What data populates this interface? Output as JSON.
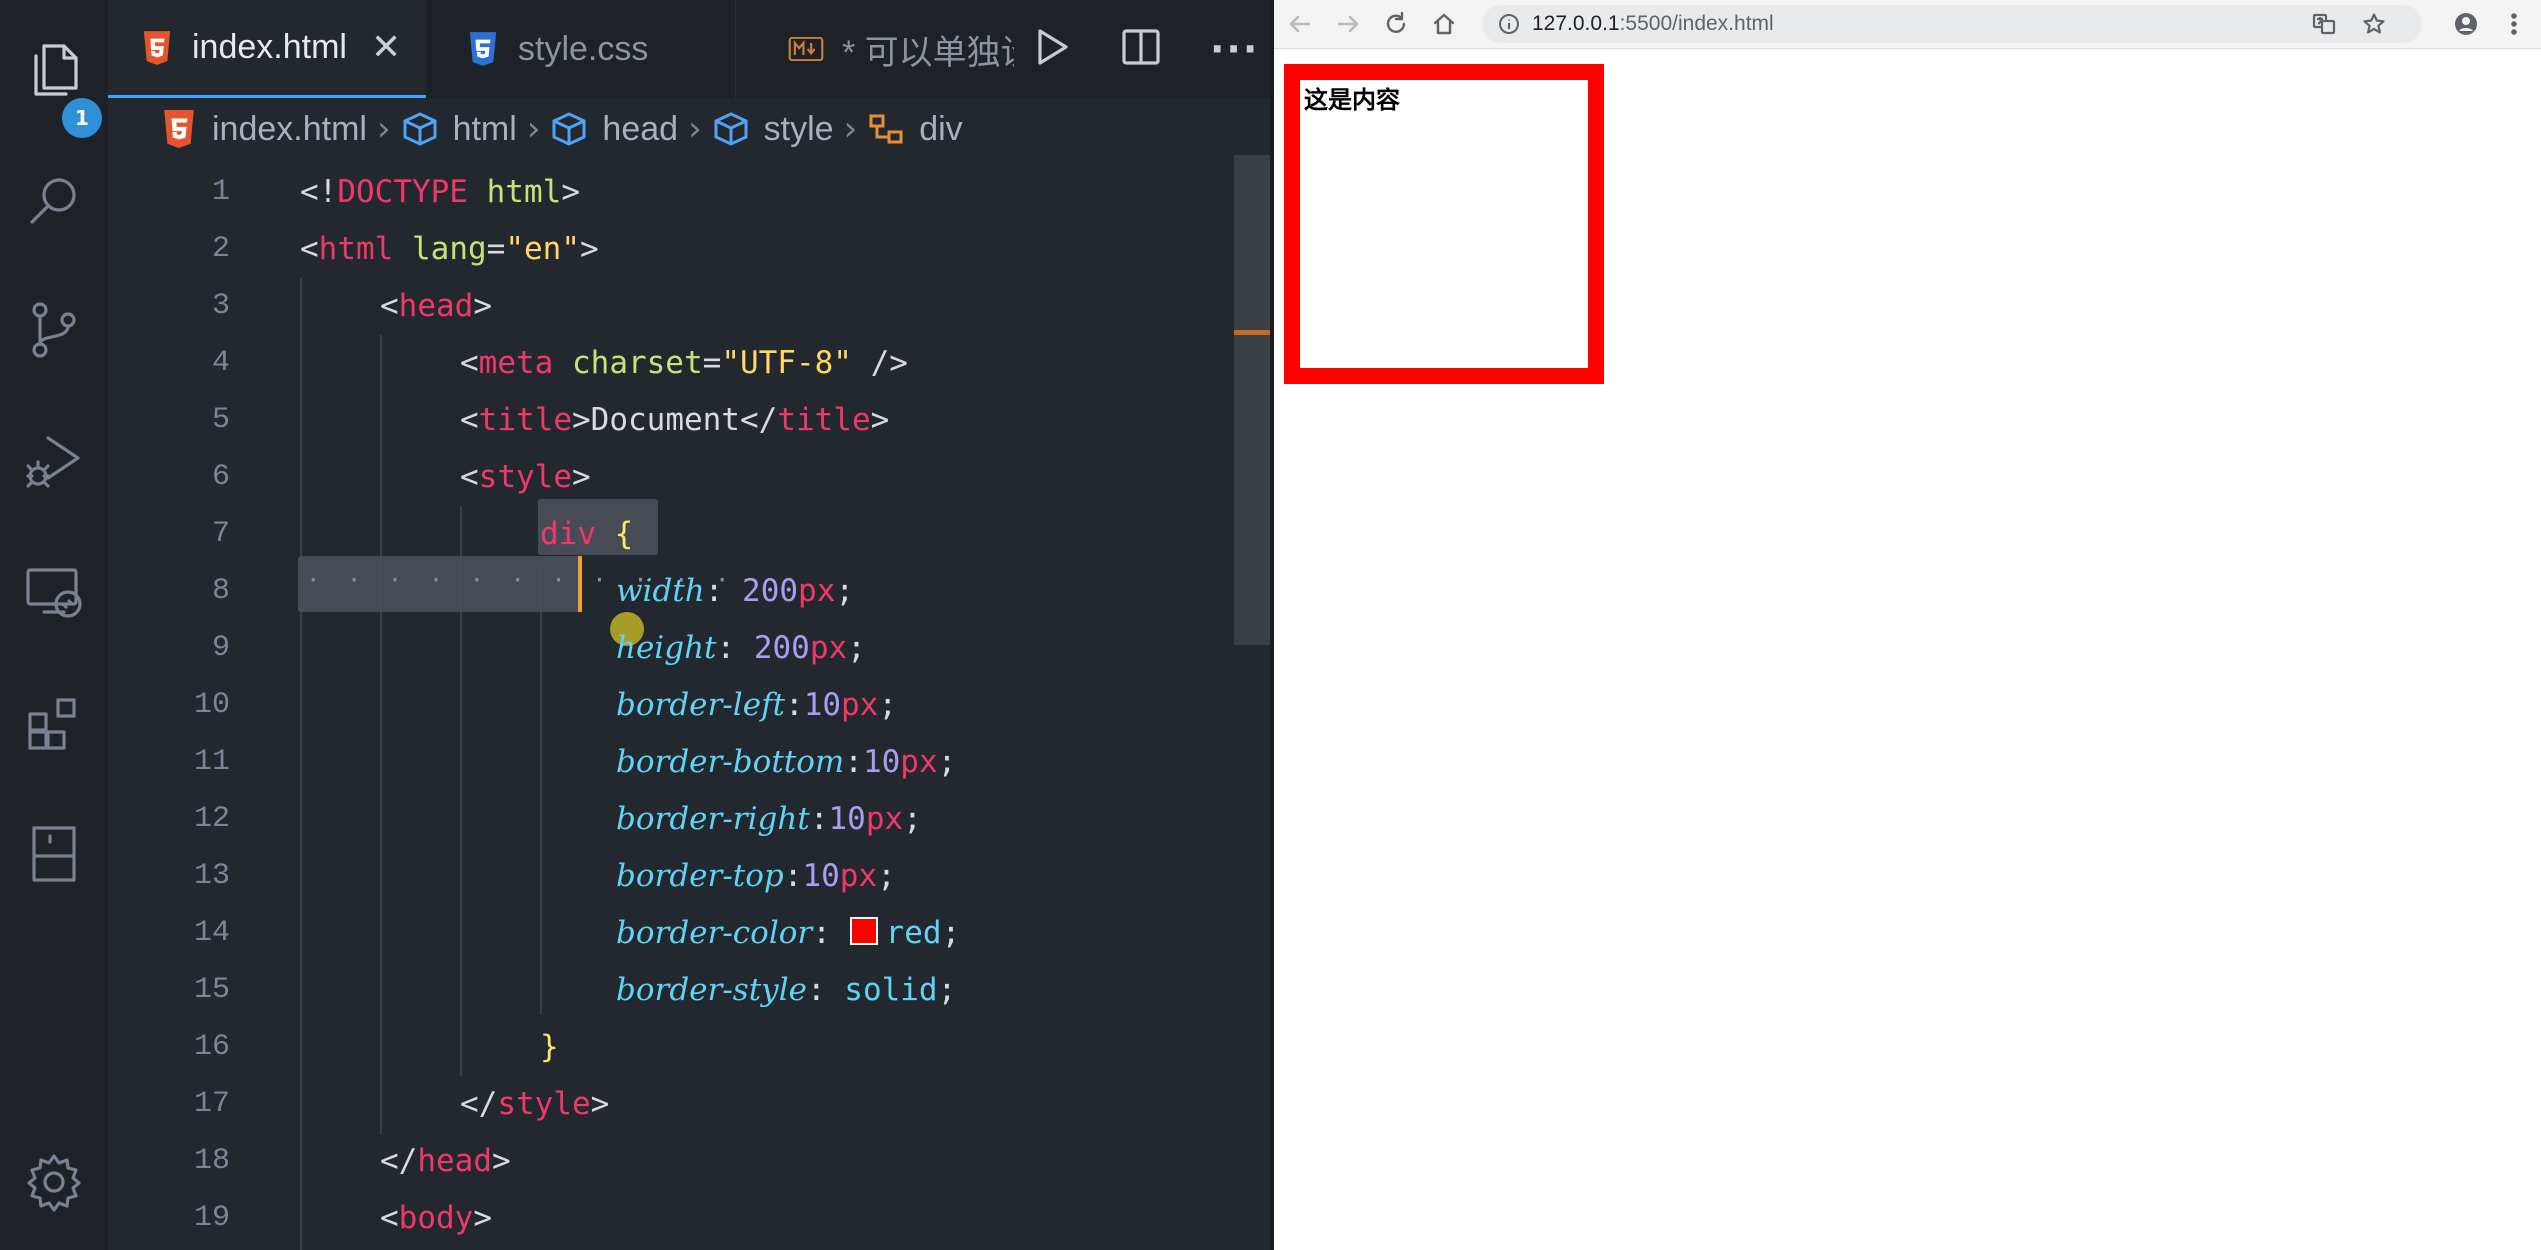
{
  "editor": {
    "scm_badge": "1",
    "tabs": [
      {
        "label": "index.html",
        "icon": "html5-file-icon",
        "active": true
      },
      {
        "label": "style.css",
        "icon": "css3-file-icon",
        "active": false
      },
      {
        "label": "* 可以单独设",
        "icon": "markdown-file-icon",
        "active": false
      }
    ],
    "breadcrumb": [
      "index.html",
      "html",
      "head",
      "style",
      "div"
    ],
    "line_numbers": [
      "1",
      "2",
      "3",
      "4",
      "5",
      "6",
      "7",
      "8",
      "9",
      "10",
      "11",
      "12",
      "13",
      "14",
      "15",
      "16",
      "17",
      "18",
      "19"
    ],
    "code": {
      "l1": {
        "a": "<!",
        "b": "DOCTYPE",
        "c": " html",
        "d": ">"
      },
      "l2": {
        "a": "<",
        "b": "html",
        "c": " lang",
        "d": "=",
        "e": "\"en\"",
        "f": ">"
      },
      "l3": {
        "a": "<",
        "b": "head",
        "c": ">"
      },
      "l4": {
        "a": "<",
        "b": "meta",
        "c": " charset",
        "d": "=",
        "e": "\"UTF-8\"",
        "f": " />"
      },
      "l5": {
        "a": "<",
        "b": "title",
        "c": ">Document</",
        "d": "title",
        "e": ">"
      },
      "l6": {
        "a": "<",
        "b": "style",
        "c": ">"
      },
      "l7": {
        "a": "div",
        "b": " {"
      },
      "l8": {
        "p": "width",
        "c": ": ",
        "n": "200",
        "u": "px",
        "s": ";"
      },
      "l9": {
        "p": "height",
        "c": ": ",
        "n": "200",
        "u": "px",
        "s": ";"
      },
      "l10": {
        "p": "border-left",
        "c": ":",
        "n": "10",
        "u": "px",
        "s": ";"
      },
      "l11": {
        "p": "border-bottom",
        "c": ":",
        "n": "10",
        "u": "px",
        "s": ";"
      },
      "l12": {
        "p": "border-right",
        "c": ":",
        "n": "10",
        "u": "px",
        "s": ";"
      },
      "l13": {
        "p": "border-top",
        "c": ":",
        "n": "10",
        "u": "px",
        "s": ";"
      },
      "l14": {
        "p": "border-color",
        "c": ": ",
        "v": "red",
        "s": ";"
      },
      "l15": {
        "p": "border-style",
        "c": ": ",
        "v": "solid",
        "s": ";"
      },
      "l16": {
        "a": "}"
      },
      "l17": {
        "a": "</",
        "b": "style",
        "c": ">"
      },
      "l18": {
        "a": "</",
        "b": "head",
        "c": ">"
      },
      "l19": {
        "a": "<",
        "b": "body",
        "c": ">"
      }
    },
    "whitespace_dots": "· · · · · · · · · · ·"
  },
  "browser": {
    "url_host": "127.0.0.1",
    "url_path": ":5500/index.html",
    "content_text": "这是内容",
    "box_border_color": "#ff0000"
  },
  "colors": {
    "accent": "#3ea6ff",
    "tag": "#f0396b",
    "string": "#ffd866",
    "property": "#5fd4f4",
    "number": "#ab9df2"
  }
}
